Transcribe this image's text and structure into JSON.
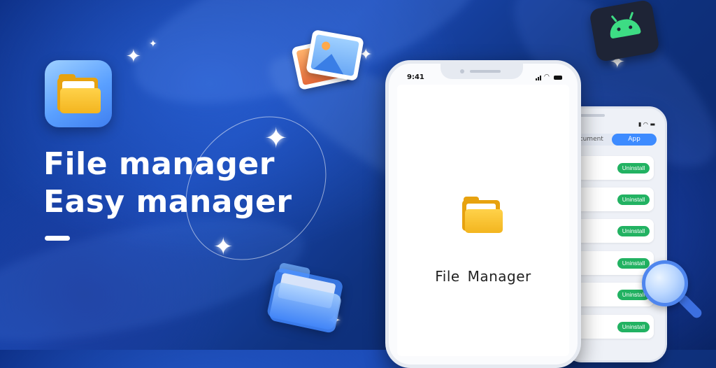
{
  "banner": {
    "headline_line1": "File manager",
    "headline_line2": "Easy manager"
  },
  "phone_main": {
    "status_time": "9:41",
    "splash_title": "File  Manager"
  },
  "phone_back": {
    "tabs": [
      {
        "label": "ocument"
      },
      {
        "label": "App",
        "selected": true
      }
    ],
    "rows": [
      {
        "button": "Uninstall"
      },
      {
        "button": "Uninstall"
      },
      {
        "button": "Uninstall"
      },
      {
        "button": "Uninstall"
      },
      {
        "button": "Uninstall"
      },
      {
        "button": "Uninstall"
      }
    ]
  },
  "decorations": {
    "icons": [
      "folder-icon",
      "photo-gallery-icon",
      "android-icon",
      "glass-folder-icon",
      "magnifier-icon",
      "sparkle-icon"
    ]
  },
  "colors": {
    "background": "#1a49b4",
    "accent_blue": "#3d8bff",
    "uninstall_green": "#22b262",
    "folder_yellow": "#f3b51f",
    "android_green": "#3ddc84"
  }
}
